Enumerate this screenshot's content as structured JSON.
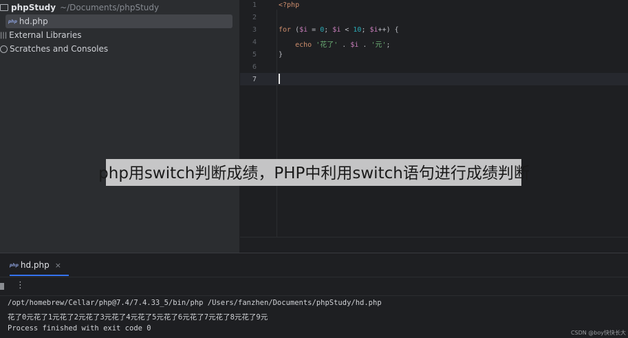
{
  "project_tree": {
    "root_name": "phpStudy",
    "root_path": "~/Documents/phpStudy",
    "file_icon": "php",
    "file": "hd.php",
    "external_libraries": "External Libraries",
    "scratches": "Scratches and Consoles"
  },
  "editor": {
    "line_numbers": [
      "1",
      "2",
      "3",
      "4",
      "5",
      "6",
      "7"
    ],
    "code": {
      "l1": "<?php",
      "l3": {
        "for": "for",
        "open": " (",
        "var1": "$i",
        "eq": " = ",
        "zero": "0",
        "semi1": "; ",
        "var2": "$i",
        "lt": " < ",
        "ten": "10",
        "semi2": "; ",
        "var3": "$i",
        "inc": "++) {"
      },
      "l4": {
        "indent": "    ",
        "echo": "echo",
        "sp": " ",
        "str1": "'花了'",
        "dot1": " . ",
        "var": "$i",
        "dot2": " . ",
        "str2": "'元'",
        "end": ";"
      },
      "l5": "}"
    }
  },
  "run_panel": {
    "tab_label": "hd.php",
    "close_icon": "×",
    "more_icon": "⋮",
    "console": [
      "/opt/homebrew/Cellar/php@7.4/7.4.33_5/bin/php /Users/fanzhen/Documents/phpStudy/hd.php",
      "花了0元花了1元花了2元花了3元花了4元花了5元花了6元花了7元花了8元花了9元",
      "Process finished with exit code 0"
    ]
  },
  "overlay_title": "php用switch判断成绩，PHP中利用switch语句进行成绩判断",
  "watermark": "CSDN @boy快快长大",
  "colors": {
    "accent": "#3574f0",
    "keyword": "#cf8e6d",
    "variable": "#c77dba",
    "number": "#2aacb8",
    "string": "#6aab73"
  }
}
